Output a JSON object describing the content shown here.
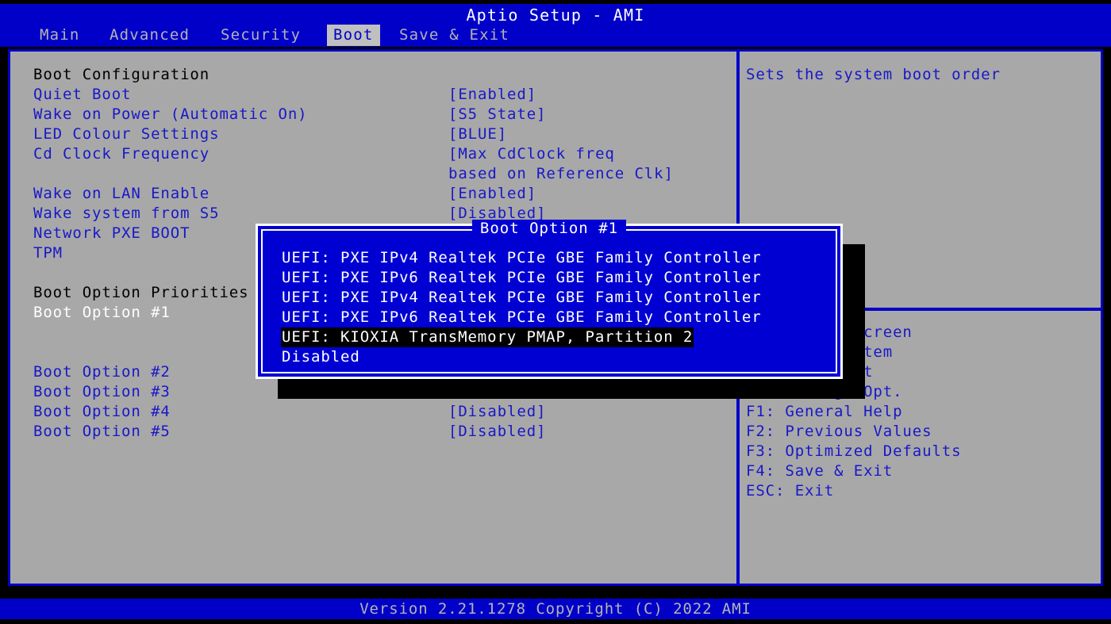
{
  "header": {
    "title": "Aptio Setup - AMI",
    "tabs": [
      {
        "label": "Main",
        "active": false
      },
      {
        "label": "Advanced",
        "active": false
      },
      {
        "label": "Security",
        "active": false
      },
      {
        "label": "Boot",
        "active": true
      },
      {
        "label": "Save & Exit",
        "active": false
      }
    ]
  },
  "colors": {
    "bios_blue": "#0000c8",
    "panel_gray": "#a8a8a8",
    "item_blue": "#1818c8",
    "selected_white": "#ffffff",
    "heading_black": "#000000",
    "popup_blue": "#0000d2",
    "shadow_black": "#000000",
    "footer_text": "#b4b4b4"
  },
  "main": {
    "rows": [
      {
        "label": "Boot Configuration",
        "value": "",
        "style": "heading"
      },
      {
        "label": "Quiet Boot",
        "value": "[Enabled]",
        "style": "item"
      },
      {
        "label": "Wake on Power (Automatic On)",
        "value": "[S5 State]",
        "style": "item"
      },
      {
        "label": "LED Colour Settings",
        "value": "[BLUE]",
        "style": "item"
      },
      {
        "label": "Cd Clock Frequency",
        "value": "[Max CdClock freq",
        "style": "item"
      },
      {
        "label": "",
        "value": "based on Reference Clk]",
        "style": "item"
      },
      {
        "label": "Wake on LAN Enable",
        "value": "[Enabled]",
        "style": "item"
      },
      {
        "label": "Wake system from S5",
        "value": "[Disabled]",
        "style": "item"
      },
      {
        "label": "Network PXE BOOT",
        "value": "",
        "style": "item"
      },
      {
        "label": "TPM",
        "value": "",
        "style": "item"
      },
      {
        "label": "",
        "value": "",
        "style": "spacer"
      },
      {
        "label": "Boot Option Priorities",
        "value": "",
        "style": "heading"
      },
      {
        "label": "Boot Option #1",
        "value": "",
        "style": "selected"
      },
      {
        "label": "",
        "value": "",
        "style": "spacer"
      },
      {
        "label": "",
        "value": "",
        "style": "spacer"
      },
      {
        "label": "Boot Option #2",
        "value": "",
        "style": "item"
      },
      {
        "label": "Boot Option #3",
        "value": "",
        "style": "item"
      },
      {
        "label": "Boot Option #4",
        "value": "[Disabled]",
        "style": "item"
      },
      {
        "label": "Boot Option #5",
        "value": "[Disabled]",
        "style": "item"
      }
    ]
  },
  "help": {
    "description": "Sets the system boot order",
    "keys": [
      "→←: Select Screen",
      "↑↓: Select Item",
      "Enter: Select",
      "+/-: Change Opt.",
      "F1: General Help",
      "F2: Previous Values",
      "F3: Optimized Defaults",
      "F4: Save & Exit",
      "ESC: Exit"
    ]
  },
  "popup": {
    "title": "Boot Option #1",
    "options": [
      {
        "label": "UEFI: PXE IPv4 Realtek PCIe GBE Family Controller",
        "selected": false
      },
      {
        "label": "UEFI: PXE IPv6 Realtek PCIe GBE Family Controller",
        "selected": false
      },
      {
        "label": "UEFI: PXE IPv4 Realtek PCIe GBE Family Controller",
        "selected": false
      },
      {
        "label": "UEFI: PXE IPv6 Realtek PCIe GBE Family Controller",
        "selected": false
      },
      {
        "label": "UEFI: KIOXIA TransMemory PMAP, Partition 2",
        "selected": true
      },
      {
        "label": "Disabled",
        "selected": false
      }
    ]
  },
  "footer": {
    "version_text": "Version 2.21.1278 Copyright (C) 2022 AMI"
  }
}
